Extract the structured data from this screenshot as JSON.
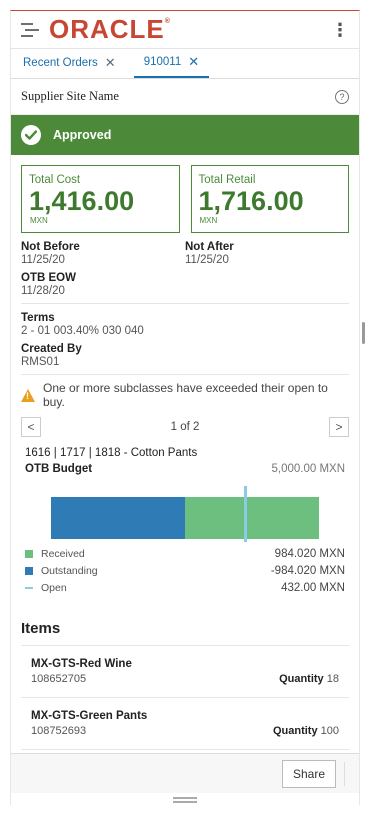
{
  "brand": {
    "logo_text": "ORACLE",
    "trademark": "®",
    "accent_color": "#c74634"
  },
  "tabs": [
    {
      "label": "Recent Orders",
      "active": false
    },
    {
      "label": "910011",
      "active": true
    }
  ],
  "supplier": {
    "label": "Supplier Site Name",
    "help_icon": "?"
  },
  "status": {
    "label": "Approved",
    "color": "#4c8a3a"
  },
  "totals": {
    "cost": {
      "label": "Total Cost",
      "value": "1,416.00",
      "unit": "MXN"
    },
    "retail": {
      "label": "Total Retail",
      "value": "1,716.00",
      "unit": "MXN"
    }
  },
  "dates": {
    "not_before": {
      "label": "Not Before",
      "value": "11/25/20"
    },
    "not_after": {
      "label": "Not After",
      "value": "11/25/20"
    },
    "otb_eow": {
      "label": "OTB EOW",
      "value": "11/28/20"
    }
  },
  "terms": {
    "label": "Terms",
    "value": "2 - 01 003.40% 030 040"
  },
  "created_by": {
    "label": "Created By",
    "value": "RMS01"
  },
  "warning": {
    "text": "One or more subclasses have exceeded their open to buy."
  },
  "pager": {
    "text": "1 of 2",
    "prev": "<",
    "next": ">"
  },
  "otb": {
    "subclass": "1616 | 1717 | 1818  -  Cotton Pants",
    "budget_label": "OTB Budget",
    "budget_amount": "5,000.00 MXN",
    "progress": {
      "outstanding_fraction": 0.5,
      "received_fraction": 0.5,
      "open_marker_fraction": 0.72
    },
    "colors": {
      "received": "#6dbf7f",
      "outstanding": "#2e7bb6",
      "open": "#8ccbe6"
    },
    "legend": [
      {
        "label": "Received",
        "value": "984.020 MXN"
      },
      {
        "label": "Outstanding",
        "value": "-984.020 MXN"
      },
      {
        "label": "Open",
        "value": "432.00 MXN"
      }
    ]
  },
  "items": {
    "title": "Items",
    "quantity_label": "Quantity",
    "list": [
      {
        "name": "MX-GTS-Red Wine",
        "id": "108652705",
        "quantity": "18"
      },
      {
        "name": "MX-GTS-Green Pants",
        "id": "108752693",
        "quantity": "100"
      }
    ]
  },
  "footer": {
    "share_label": "Share"
  }
}
